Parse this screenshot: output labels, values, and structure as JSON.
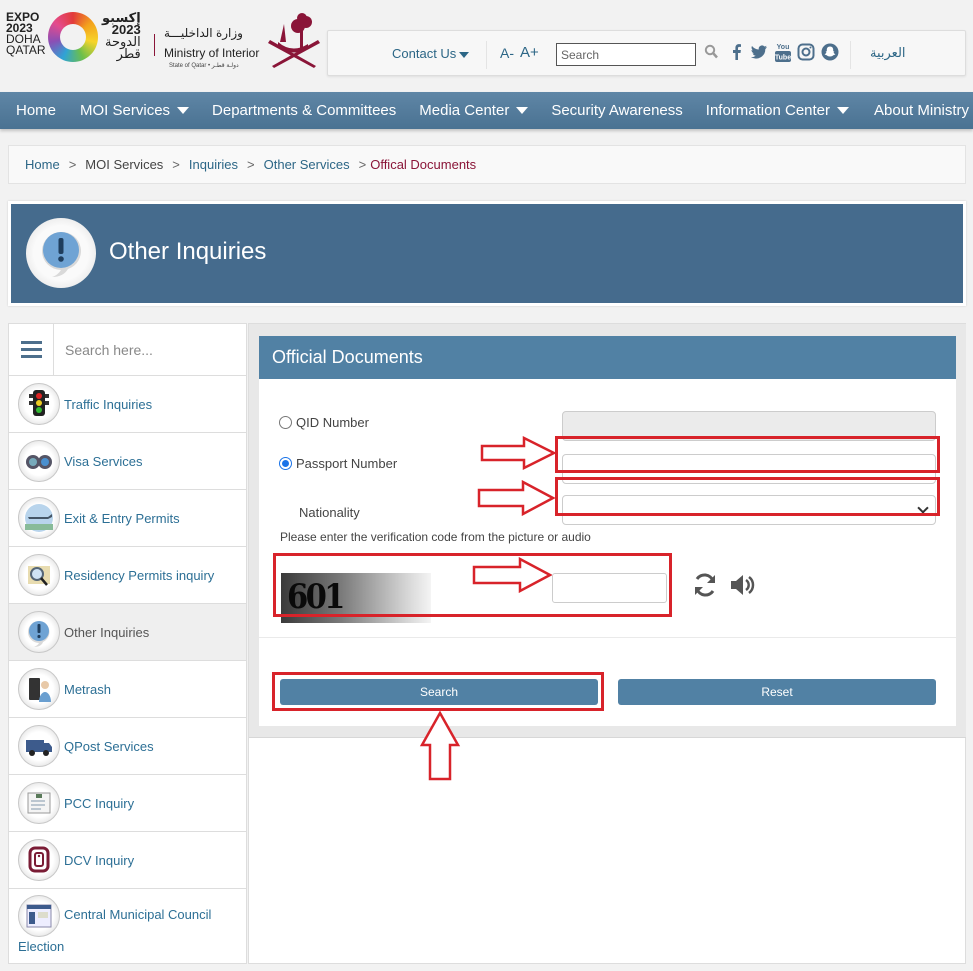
{
  "header": {
    "expo_logo": {
      "line1": "EXPO",
      "line2": "2023",
      "line3": "DOHA",
      "line4": "QATAR",
      "ar_line1": "إكسبو",
      "ar_line2": "2023",
      "ar_line3": "الدوحة",
      "ar_line4": "قطر"
    },
    "ministry_ar": "وزارة الداخليـــة",
    "ministry_en": "Ministry of Interior",
    "ministry_sub": "State of Qatar • دولـة قطـر",
    "topbar": {
      "contact_label": "Contact Us",
      "font_decrease": "A-",
      "font_increase": "A+",
      "search_placeholder": "Search",
      "language_label": "العربية",
      "social_icons": [
        "facebook-icon",
        "twitter-icon",
        "youtube-icon",
        "instagram-icon",
        "snapchat-icon"
      ]
    }
  },
  "nav": {
    "items": [
      {
        "label": "Home",
        "has_dropdown": false
      },
      {
        "label": "MOI Services",
        "has_dropdown": true
      },
      {
        "label": "Departments & Committees",
        "has_dropdown": false
      },
      {
        "label": "Media Center",
        "has_dropdown": true
      },
      {
        "label": "Security Awareness",
        "has_dropdown": false
      },
      {
        "label": "Information Center",
        "has_dropdown": true
      },
      {
        "label": "About Ministry",
        "has_dropdown": true
      }
    ]
  },
  "breadcrumb": {
    "items": [
      "Home",
      "MOI Services",
      "Inquiries",
      "Other Services",
      "Offical Documents"
    ],
    "separator": ">"
  },
  "banner": {
    "title": "Other Inquiries",
    "icon": "exclamation-bubble-icon"
  },
  "sidebar": {
    "search_placeholder": "Search here...",
    "items": [
      {
        "label": "Traffic Inquiries",
        "icon": "traffic-light-icon"
      },
      {
        "label": "Visa Services",
        "icon": "binoculars-icon"
      },
      {
        "label": "Exit & Entry Permits",
        "icon": "airplane-icon"
      },
      {
        "label": "Residency Permits inquiry",
        "icon": "magnifier-document-icon"
      },
      {
        "label": "Other Inquiries",
        "icon": "exclamation-bubble-icon",
        "active": true
      },
      {
        "label": "Metrash",
        "icon": "phone-person-icon"
      },
      {
        "label": "QPost Services",
        "icon": "delivery-van-icon"
      },
      {
        "label": "PCC Inquiry",
        "icon": "certificate-icon"
      },
      {
        "label": "DCV Inquiry",
        "icon": "dcv-logo-icon"
      },
      {
        "label": "Central Municipal Council",
        "label_line2": "Election",
        "icon": "ballot-icon"
      }
    ]
  },
  "form": {
    "title": "Official Documents",
    "qid_label": "QID Number",
    "qid_value": "",
    "passport_label": "Passport Number",
    "passport_value": "",
    "selected_option": "passport",
    "nationality_label": "Nationality",
    "nationality_selected": "............",
    "verification_text": "Please enter the verification code from the picture or audio",
    "captcha_code": "601",
    "captcha_value": "",
    "search_label": "Search",
    "reset_label": "Reset"
  },
  "colors": {
    "accent": "#5181a4",
    "banner": "#456b8d",
    "link": "#2c6f95",
    "breadcrumb_current": "#8a1538",
    "annotation": "#d8232a"
  }
}
